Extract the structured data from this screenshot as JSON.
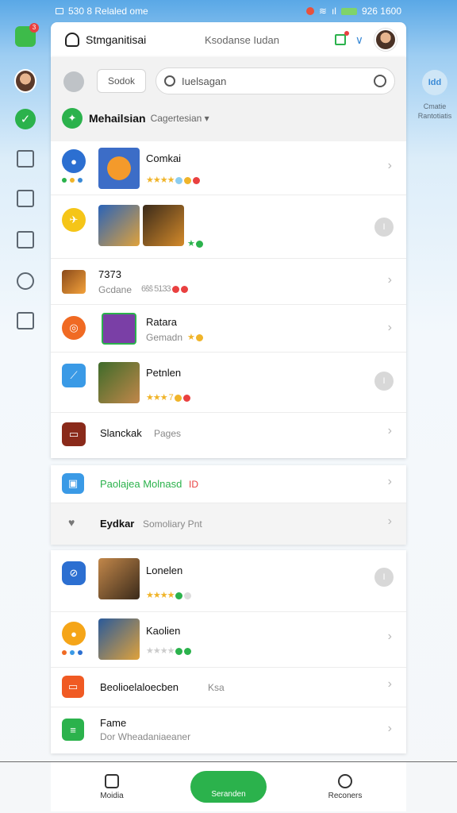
{
  "status_bar": {
    "left_text": "530 8 Relaled ome",
    "right_text": "926 1600"
  },
  "top_bar": {
    "title": "Stmganitisai",
    "subtitle": "Ksodanse Iudan"
  },
  "right_card": {
    "label_line1": "Cmatie",
    "label_line2": "Rantotiatis",
    "icon_text": "Idd"
  },
  "panel_head": {
    "chip_label": "Sodok",
    "search_text": "Iuelsagan",
    "title": "Mehailsian",
    "subtitle": "Cagertesian ▾"
  },
  "rows": [
    {
      "title": "Comkai",
      "sub": "",
      "stars": "★★★★",
      "has_gray_dot": false,
      "gray_dot_label": ""
    },
    {
      "title": "",
      "sub": "",
      "stars": "★",
      "has_gray_dot": true,
      "gray_dot_label": "I"
    },
    {
      "title": "7373",
      "sub": "Gcdane",
      "stars": "6ŝŝ 5133",
      "has_gray_dot": false,
      "gray_dot_label": ""
    },
    {
      "title": "Ratara",
      "sub": "Gemadn",
      "stars": "★",
      "has_gray_dot": false,
      "gray_dot_label": ""
    },
    {
      "title": "Petnlen",
      "sub": "",
      "stars": "★★★ 7",
      "has_gray_dot": true,
      "gray_dot_label": "I"
    },
    {
      "title": "Slanckak",
      "sub": "Pages",
      "stars": "",
      "has_gray_dot": false,
      "gray_dot_label": ""
    }
  ],
  "panel2": [
    {
      "title": "Paolajea Molnasd",
      "suffix": "ID"
    },
    {
      "title": "Eydkar",
      "suffix": "Somoliary Pnt"
    }
  ],
  "panel3": [
    {
      "title": "Lonelen",
      "stars": "★★★★",
      "has_gray_dot": true,
      "gray_dot_label": "I"
    },
    {
      "title": "Kaolien",
      "stars": "★★★★",
      "has_gray_dot": false,
      "gray_dot_label": ""
    },
    {
      "title": "Beolioelaloecben",
      "sub": "Ksa"
    },
    {
      "title": "Fame",
      "sub": "Dor Wheadaniaeaner"
    }
  ],
  "bottom_nav": {
    "left_label": "Moidia",
    "center_label": "Seranden",
    "right_label": "Reconers"
  },
  "colors": {
    "accent_green": "#2bb24c",
    "accent_blue": "#3a8ad6",
    "badge_red": "#e94040"
  }
}
